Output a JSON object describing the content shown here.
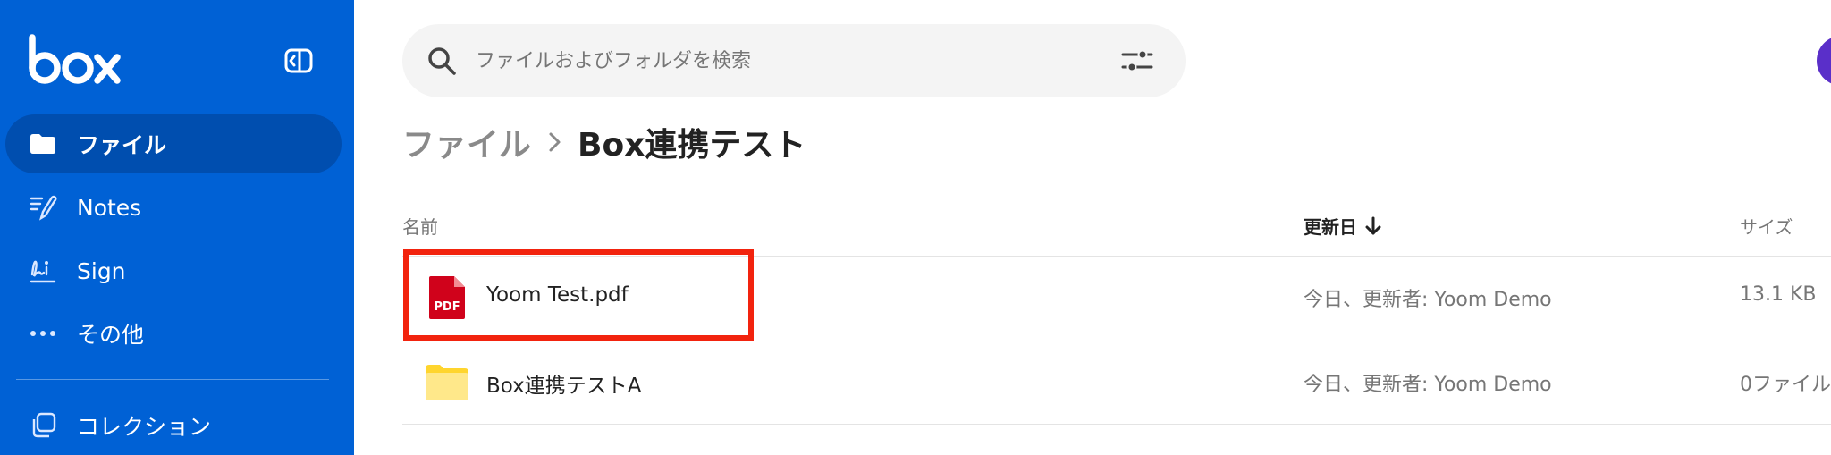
{
  "sidebar": {
    "logo_text": "box",
    "items": [
      {
        "label": "ファイル",
        "icon": "folder-icon",
        "active": true
      },
      {
        "label": "Notes",
        "icon": "notes-icon",
        "active": false
      },
      {
        "label": "Sign",
        "icon": "sign-icon",
        "active": false
      },
      {
        "label": "その他",
        "icon": "more-dots-icon",
        "active": false
      },
      {
        "label": "コレクション",
        "icon": "collections-icon",
        "active": false
      }
    ]
  },
  "search": {
    "placeholder": "ファイルおよびフォルダを検索",
    "value": ""
  },
  "breadcrumb": {
    "parent": "ファイル",
    "current": "Box連携テスト"
  },
  "table": {
    "columns": {
      "name": "名前",
      "updated": "更新日",
      "size": "サイズ"
    },
    "rows": [
      {
        "name": "Yoom Test.pdf",
        "updated": "今日、更新者: Yoom Demo",
        "size": "13.1 KB",
        "icon": "pdf-file-icon",
        "icon_label": "PDF"
      },
      {
        "name": "Box連携テストA",
        "updated": "今日、更新者: Yoom Demo",
        "size": "0ファイル",
        "icon": "folder-icon"
      }
    ]
  },
  "colors": {
    "sidebar_bg": "#0061d5",
    "sidebar_active": "#004eaf",
    "highlight": "#f2230e",
    "pdf_red": "#d0021b",
    "folder_yellow": "#ffd52e"
  }
}
